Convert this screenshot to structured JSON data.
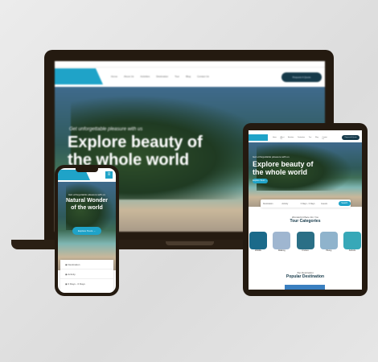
{
  "site": {
    "nav": [
      "Home",
      "About Us",
      "Activities",
      "Destination",
      "Tour",
      "Blog",
      "Contact Us"
    ],
    "book_button": "Request A Quote",
    "hero_tagline": "Get unforgettable pleasure with us",
    "hero_title_line1": "Explore beauty of",
    "hero_title_line2": "the whole world",
    "explore_button": "Explore Tours →",
    "search": {
      "fields": [
        "Destination",
        "Activity",
        "0 Days - 0 Days",
        "Guests"
      ],
      "button": "Search"
    },
    "categories_tagline": "Wonderful Place For You",
    "categories_title": "Tour Categories",
    "categories": [
      "Wildlife",
      "Walking",
      "Cruises",
      "Hiking",
      "Airbirds"
    ],
    "popular_tagline": "Top Destination",
    "popular_title": "Popular Destination"
  },
  "mobile": {
    "hero_tagline": "Get unforgettable pleasure with us",
    "hero_title_line1": "Natural Wonder",
    "hero_title_line2": "of the world",
    "explore_button": "Explore Tours →",
    "fields": [
      "Destination",
      "Activity",
      "0 Days - 0 Days"
    ]
  },
  "colors": {
    "accent": "#1fa3c8",
    "frame": "#241a10",
    "dark_button": "#163a4a"
  }
}
